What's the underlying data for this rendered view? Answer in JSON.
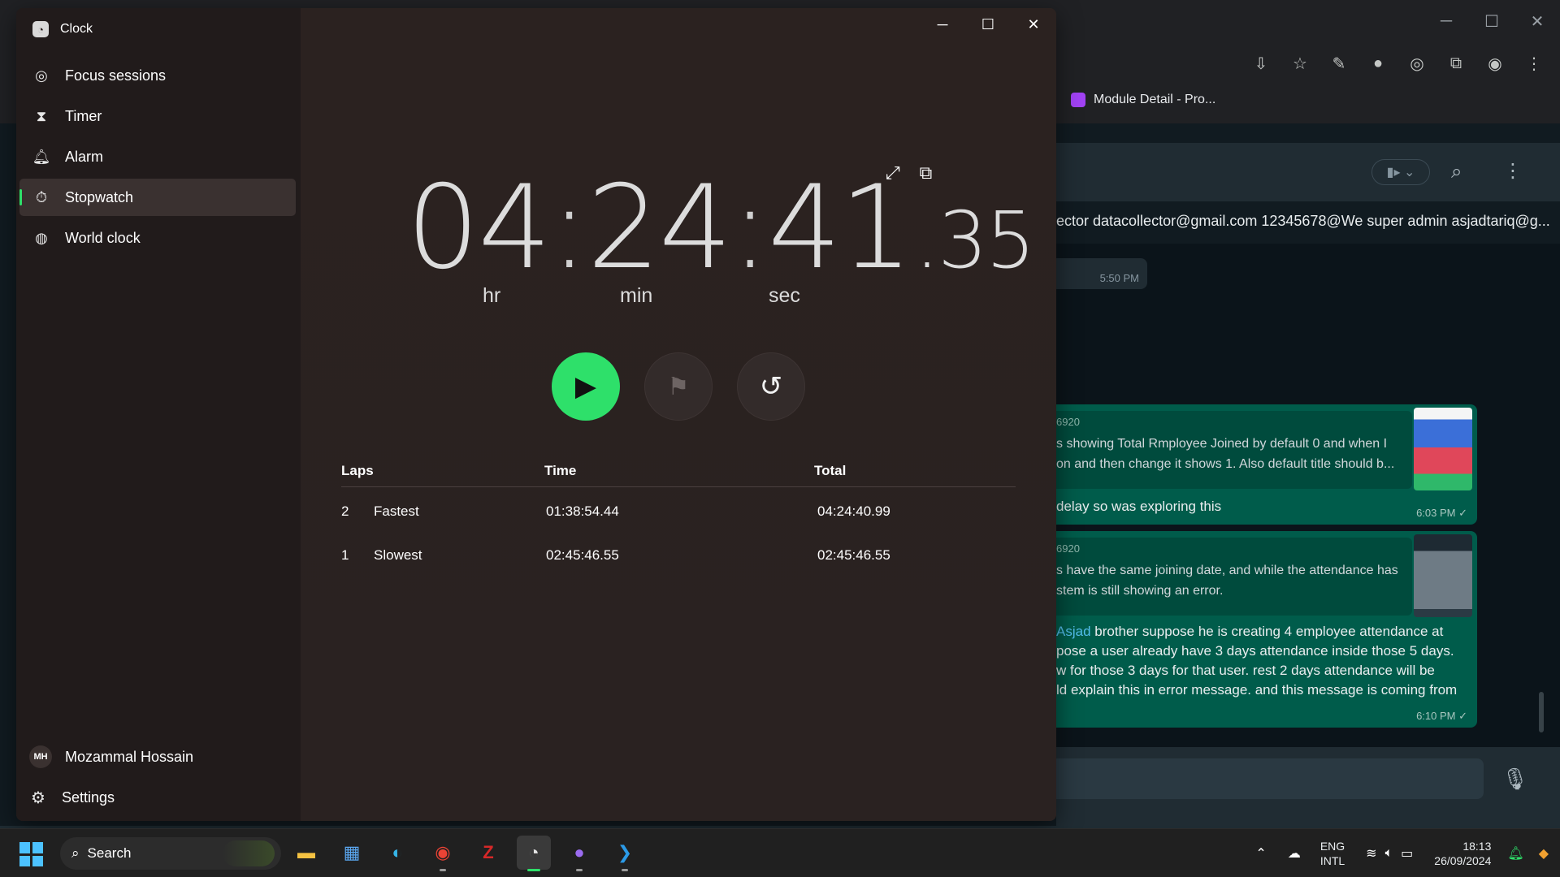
{
  "background": {
    "bookmark": "Module Detail - Pro...",
    "chat_members": "ector datacollector@gmail.com 12345678@We super admin asjadtariq@g...",
    "messages": [
      {
        "time": "5:50 PM"
      },
      {
        "quote_id": "6920",
        "quote_text": [
          "s showing Total Rmployee Joined by default 0 and when I",
          "on and then change it shows 1.  Also default title should b..."
        ],
        "body": [
          " delay so was exploring this"
        ],
        "time": "6:03 PM ✓"
      },
      {
        "quote_id": "6920",
        "quote_text": [
          "s have the same joining date, and while the attendance has",
          "stem is still showing an error."
        ],
        "mention": "Asjad",
        "body": [
          " brother suppose he is creating 4 employee attendance at",
          "pose a user already have 3 days attendance inside those 5 days.",
          "w for those 3 days for that user. rest 2 days attendance will be",
          "ld explain this in error message. and this message is coming from"
        ],
        "time": "6:10 PM ✓"
      }
    ]
  },
  "clock": {
    "app_title": "Clock",
    "nav": [
      {
        "label": "Focus sessions",
        "icon": "focus-icon"
      },
      {
        "label": "Timer",
        "icon": "hourglass-icon"
      },
      {
        "label": "Alarm",
        "icon": "bell-icon"
      },
      {
        "label": "Stopwatch",
        "icon": "stopwatch-icon",
        "active": true
      },
      {
        "label": "World clock",
        "icon": "globe-icon"
      }
    ],
    "user": {
      "initials": "MH",
      "name": "Mozammal Hossain"
    },
    "settings_label": "Settings",
    "stopwatch": {
      "hours": "04",
      "minutes": "24",
      "seconds": "41",
      "fraction": ".35",
      "unit_hr": "hr",
      "unit_min": "min",
      "unit_sec": "sec"
    },
    "laps": {
      "headers": {
        "laps": "Laps",
        "time": "Time",
        "total": "Total"
      },
      "rows": [
        {
          "num": "2",
          "label": "Fastest",
          "time": "01:38:54.44",
          "total": "04:24:40.99"
        },
        {
          "num": "1",
          "label": "Slowest",
          "time": "02:45:46.55",
          "total": "02:45:46.55"
        }
      ]
    },
    "accent_color": "#2ee06a"
  },
  "taskbar": {
    "search_label": "Search",
    "lang_line1": "ENG",
    "lang_line2": "INTL",
    "time": "18:13",
    "date": "26/09/2024"
  }
}
